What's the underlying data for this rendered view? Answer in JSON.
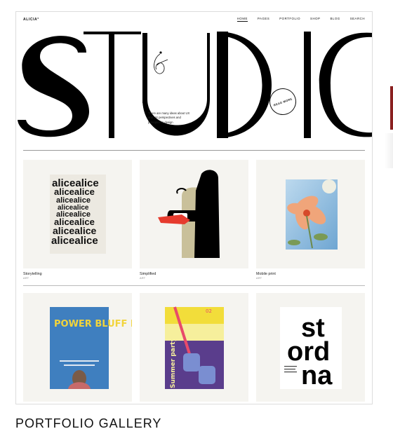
{
  "site": {
    "logo": "ALICIA°",
    "nav": [
      "HOME",
      "PAGES",
      "PORTFOLIO",
      "SHOP",
      "BLOG",
      "SEARCH"
    ],
    "nav_active": "HOME"
  },
  "hero": {
    "word": "STUDIO",
    "intro": "There are many ideas about UX and UX perspectives and principles in design",
    "read_label": "READ MORE"
  },
  "cards": [
    {
      "caption": "Storytelling",
      "category": "ART",
      "poster_text": "alicealice"
    },
    {
      "caption": "Simplified",
      "category": "ART"
    },
    {
      "caption": "Mobile print",
      "category": "ART"
    },
    {
      "caption": "",
      "category": "",
      "poster_text": "POWER BLUFF FLOWERS"
    },
    {
      "caption": "",
      "category": "",
      "poster_text": "Summer party",
      "poster_num": "02"
    },
    {
      "caption": "",
      "category": "",
      "poster_text": "st ord na"
    }
  ],
  "colors": {
    "accent_red": "#8a2020",
    "tile_bg": "#f5f4f0"
  },
  "page_title": "PORTFOLIO GALLERY"
}
